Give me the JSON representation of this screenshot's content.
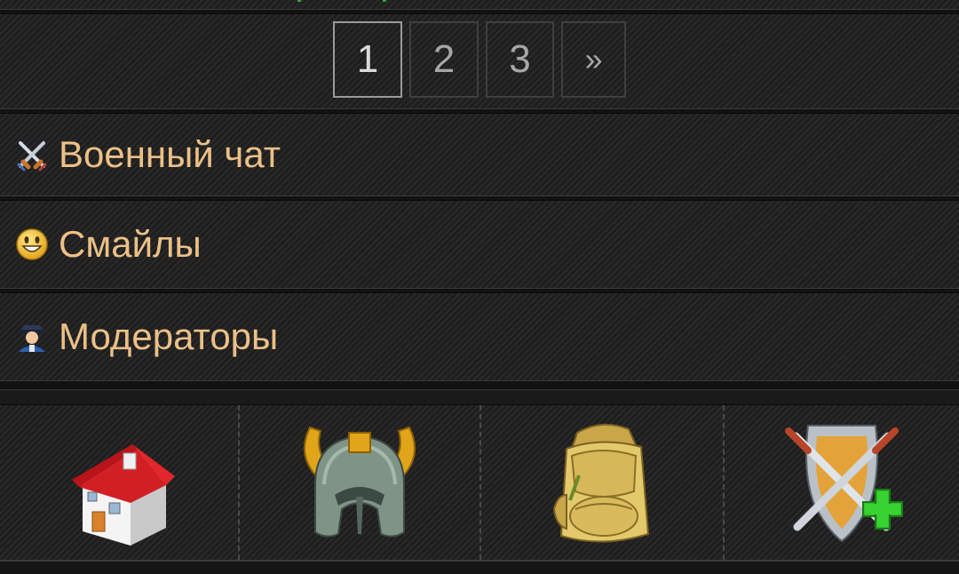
{
  "pagination": {
    "pages": [
      "1",
      "2",
      "3"
    ],
    "next_label": "»",
    "current": "1"
  },
  "menu": {
    "military_chat": {
      "label": "Военный чат",
      "icon": "crossed-swords-icon"
    },
    "smileys": {
      "label": "Смайлы",
      "icon": "smiley-icon"
    },
    "moderators": {
      "label": "Модераторы",
      "icon": "moderator-icon"
    }
  },
  "bottom_nav": [
    {
      "name": "home",
      "icon": "house-icon"
    },
    {
      "name": "hero",
      "icon": "viking-helmet-icon"
    },
    {
      "name": "inventory",
      "icon": "backpack-icon"
    },
    {
      "name": "battle",
      "icon": "shield-swords-plus-icon"
    }
  ],
  "colors": {
    "label_text": "#ecc087",
    "page_text": "#a7a7a7",
    "active_border": "#9a9a9a"
  }
}
